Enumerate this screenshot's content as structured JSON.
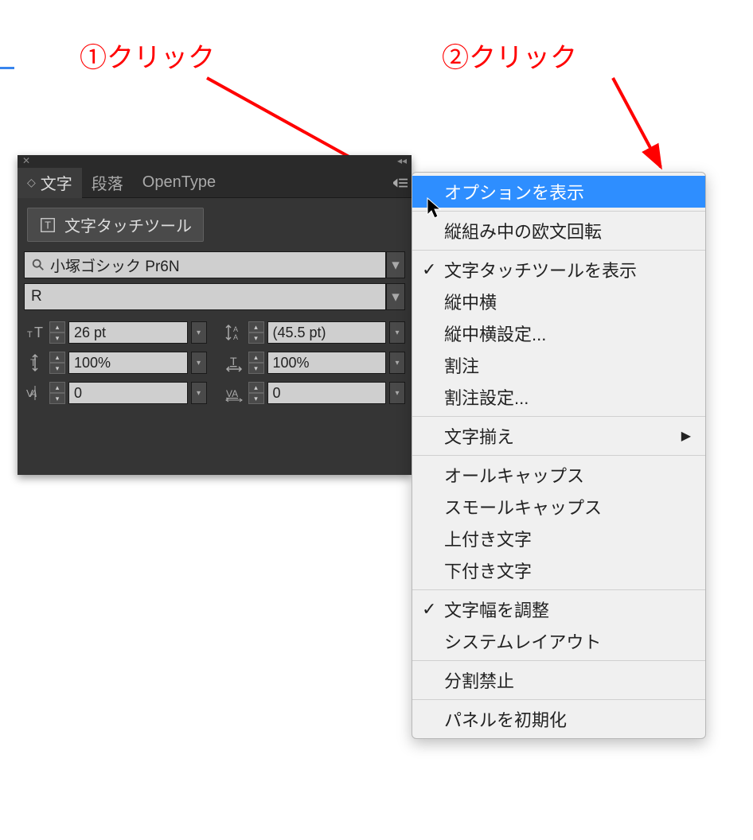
{
  "annotations": {
    "label1": "①クリック",
    "label2": "②クリック"
  },
  "panel": {
    "tabs": {
      "character": "文字",
      "paragraph": "段落",
      "opentype": "OpenType"
    },
    "touch_tool_label": "文字タッチツール",
    "font_name": "小塚ゴシック Pr6N",
    "font_style": "R",
    "controls": {
      "font_size": "26 pt",
      "leading": "(45.5 pt)",
      "vert_scale": "100%",
      "horiz_scale": "100%",
      "kerning": "0",
      "tracking": "0"
    }
  },
  "menu": {
    "items": [
      {
        "label": "オプションを表示",
        "highlight": true
      },
      {
        "sep": true
      },
      {
        "label": "縦組み中の欧文回転"
      },
      {
        "sep": true
      },
      {
        "label": "文字タッチツールを表示",
        "checked": true
      },
      {
        "label": "縦中横"
      },
      {
        "label": "縦中横設定..."
      },
      {
        "label": "割注"
      },
      {
        "label": "割注設定..."
      },
      {
        "sep": true
      },
      {
        "label": "文字揃え",
        "submenu": true
      },
      {
        "sep": true
      },
      {
        "label": "オールキャップス"
      },
      {
        "label": "スモールキャップス"
      },
      {
        "label": "上付き文字"
      },
      {
        "label": "下付き文字"
      },
      {
        "sep": true
      },
      {
        "label": "文字幅を調整",
        "checked": true
      },
      {
        "label": "システムレイアウト"
      },
      {
        "sep": true
      },
      {
        "label": "分割禁止"
      },
      {
        "sep": true
      },
      {
        "label": "パネルを初期化"
      }
    ]
  }
}
